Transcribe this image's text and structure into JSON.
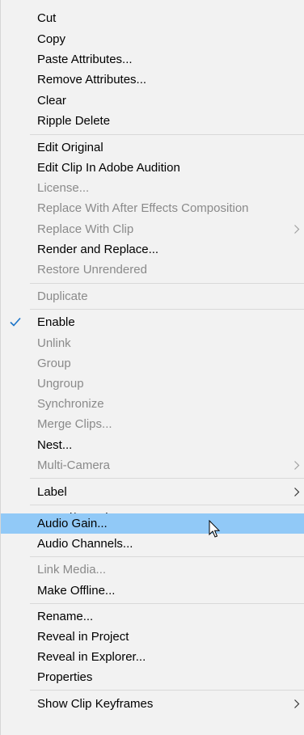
{
  "menu": {
    "items": [
      {
        "label": "Cut",
        "disabled": false
      },
      {
        "label": "Copy",
        "disabled": false
      },
      {
        "label": "Paste Attributes...",
        "disabled": false
      },
      {
        "label": "Remove Attributes...",
        "disabled": false
      },
      {
        "label": "Clear",
        "disabled": false
      },
      {
        "label": "Ripple Delete",
        "disabled": false
      },
      {
        "label": "Edit Original",
        "disabled": false
      },
      {
        "label": "Edit Clip In Adobe Audition",
        "disabled": false
      },
      {
        "label": "License...",
        "disabled": true
      },
      {
        "label": "Replace With After Effects Composition",
        "disabled": true
      },
      {
        "label": "Replace With Clip",
        "disabled": true,
        "submenu": true
      },
      {
        "label": "Render and Replace...",
        "disabled": false
      },
      {
        "label": "Restore Unrendered",
        "disabled": true
      },
      {
        "label": "Duplicate",
        "disabled": true
      },
      {
        "label": "Enable",
        "disabled": false,
        "checked": true
      },
      {
        "label": "Unlink",
        "disabled": true
      },
      {
        "label": "Group",
        "disabled": true
      },
      {
        "label": "Ungroup",
        "disabled": true
      },
      {
        "label": "Synchronize",
        "disabled": true
      },
      {
        "label": "Merge Clips...",
        "disabled": true
      },
      {
        "label": "Nest...",
        "disabled": false
      },
      {
        "label": "Multi-Camera",
        "disabled": true,
        "submenu": true
      },
      {
        "label": "Label",
        "disabled": false,
        "submenu": true
      },
      {
        "label": "Speed/Duration...",
        "disabled": false
      },
      {
        "label": "Audio Gain...",
        "disabled": false,
        "highlighted": true
      },
      {
        "label": "Audio Channels...",
        "disabled": false
      },
      {
        "label": "Link Media...",
        "disabled": true
      },
      {
        "label": "Make Offline...",
        "disabled": false
      },
      {
        "label": "Rename...",
        "disabled": false
      },
      {
        "label": "Reveal in Project",
        "disabled": false
      },
      {
        "label": "Reveal in Explorer...",
        "disabled": false
      },
      {
        "label": "Properties",
        "disabled": false
      },
      {
        "label": "Show Clip Keyframes",
        "disabled": false,
        "submenu": true
      }
    ]
  },
  "colors": {
    "background": "#f2f2f2",
    "highlight": "#91c9f7",
    "enabled_text": "#000000",
    "disabled_text": "#8a8a8a",
    "check": "#1a73c8"
  }
}
